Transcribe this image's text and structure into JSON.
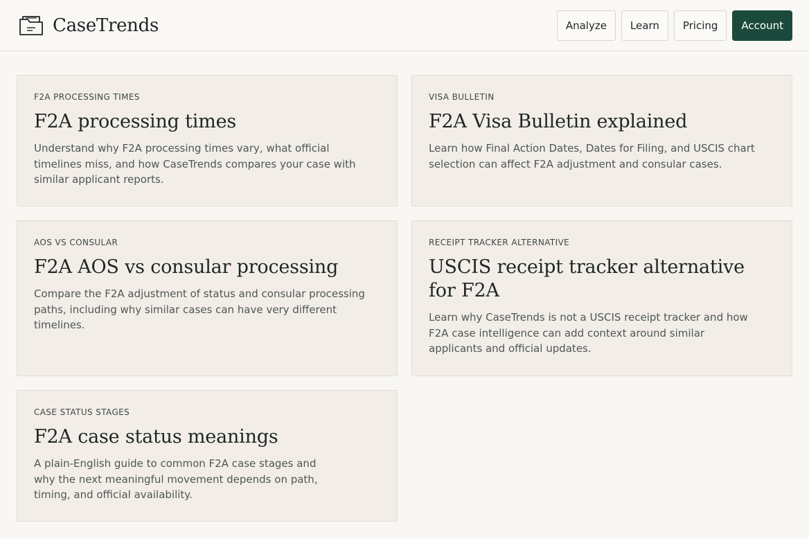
{
  "brand": {
    "name": "CaseTrends",
    "icon": "folder-icon"
  },
  "nav": {
    "analyze": "Analyze",
    "learn": "Learn",
    "pricing": "Pricing",
    "account": "Account"
  },
  "colors": {
    "accent": "#1b4a3c",
    "card_bg": "#f2eee7",
    "page_bg": "#f8f7f3"
  },
  "cards": [
    {
      "kicker": "F2A PROCESSING TIMES",
      "title": "F2A processing times",
      "description": "Understand why F2A processing times vary, what official timelines miss, and how CaseTrends compares your case with similar applicant reports."
    },
    {
      "kicker": "VISA BULLETIN",
      "title": "F2A Visa Bulletin explained",
      "description": "Learn how Final Action Dates, Dates for Filing, and USCIS chart selection can affect F2A adjustment and consular cases."
    },
    {
      "kicker": "AOS VS CONSULAR",
      "title": "F2A AOS vs consular processing",
      "description": "Compare the F2A adjustment of status and consular processing paths, including why similar cases can have very different timelines."
    },
    {
      "kicker": "RECEIPT TRACKER ALTERNATIVE",
      "title": "USCIS receipt tracker alternative for F2A",
      "description": "Learn why CaseTrends is not a USCIS receipt tracker and how F2A case intelligence can add context around similar applicants and official updates."
    },
    {
      "kicker": "CASE STATUS STAGES",
      "title": "F2A case status meanings",
      "description": "A plain-English guide to common F2A case stages and why the next meaningful movement depends on path, timing, and official availability."
    }
  ]
}
